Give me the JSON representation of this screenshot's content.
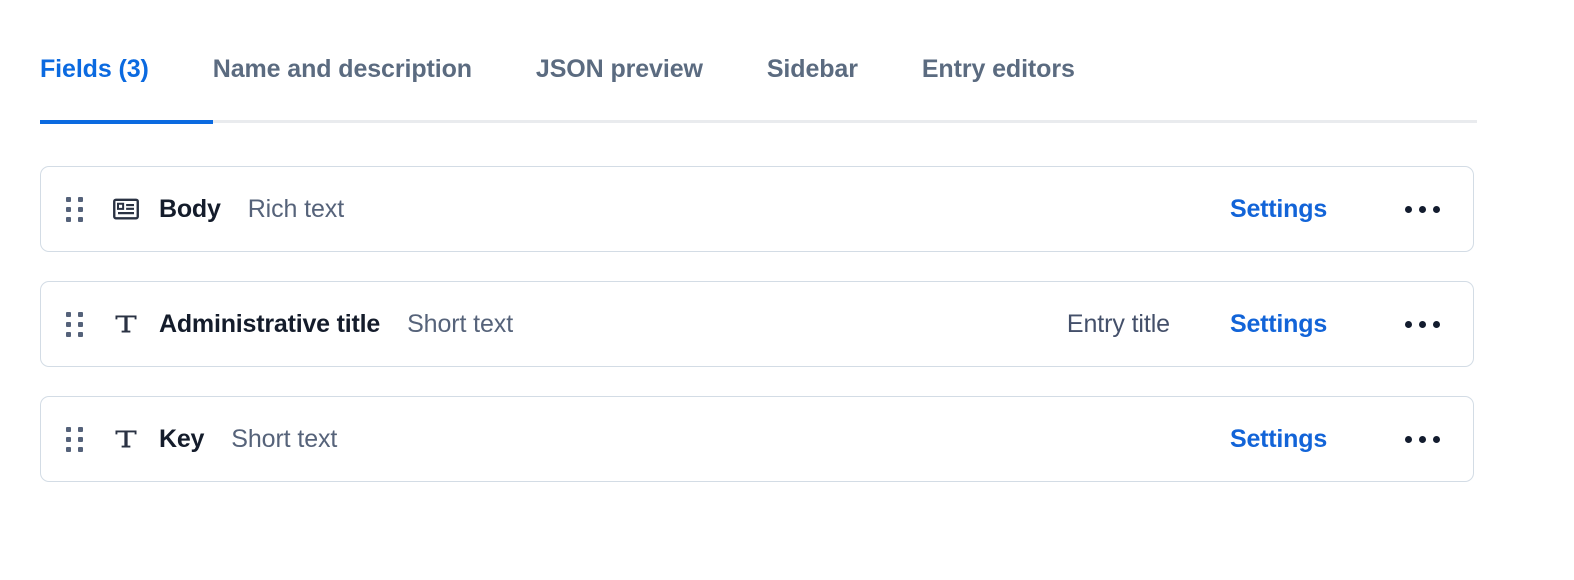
{
  "tabs": [
    {
      "label": "Fields (3)",
      "active": true,
      "name": "tab-fields"
    },
    {
      "label": "Name and description",
      "active": false,
      "name": "tab-name-and-description"
    },
    {
      "label": "JSON preview",
      "active": false,
      "name": "tab-json-preview"
    },
    {
      "label": "Sidebar",
      "active": false,
      "name": "tab-sidebar"
    },
    {
      "label": "Entry editors",
      "active": false,
      "name": "tab-entry-editors"
    }
  ],
  "colors": {
    "accent": "#0b6ae0",
    "link": "#1264d8",
    "tab_inactive": "#5b6b80",
    "card_border": "#d3dce5",
    "underline_track": "#e9ebee",
    "field_name": "#141c2b",
    "field_type": "#56637a",
    "icon": "#2a3243",
    "drag_dot": "#55627a",
    "kebab_dot": "#131c2e",
    "background": "#ffffff"
  },
  "fields": [
    {
      "name": "Body",
      "type": "Rich text",
      "flag": "",
      "icon": "rich-text-icon",
      "settings_label": "Settings",
      "menu_label": "•••"
    },
    {
      "name": "Administrative title",
      "type": "Short text",
      "flag": "Entry title",
      "icon": "short-text-icon",
      "settings_label": "Settings",
      "menu_label": "•••"
    },
    {
      "name": "Key",
      "type": "Short text",
      "flag": "",
      "icon": "short-text-icon",
      "settings_label": "Settings",
      "menu_label": "•••"
    }
  ]
}
